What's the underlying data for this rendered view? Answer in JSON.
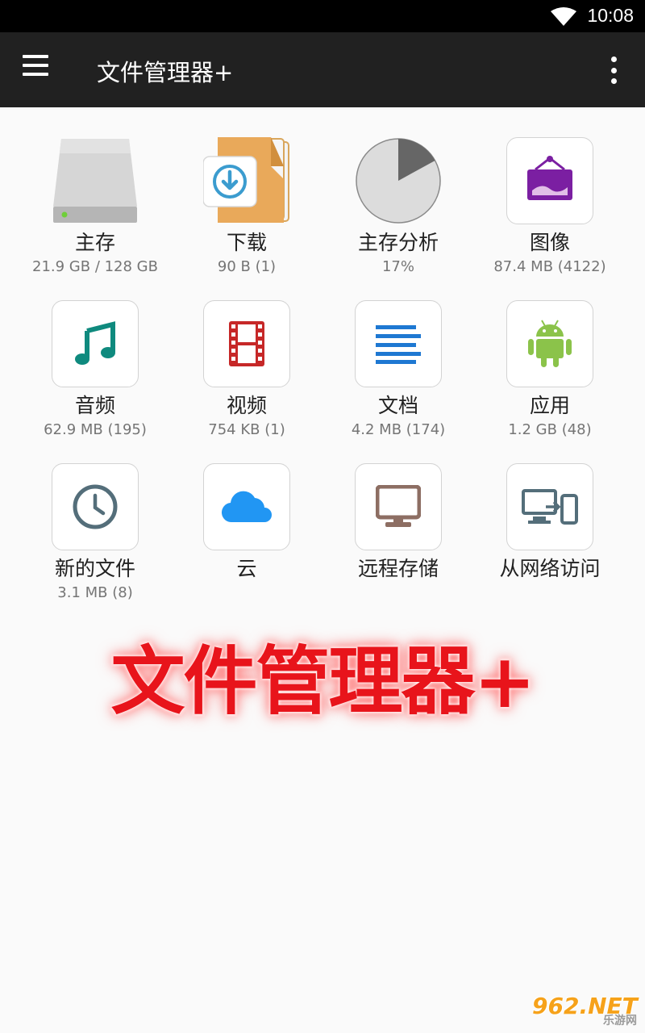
{
  "status_bar": {
    "time": "10:08",
    "wifi_icon": "wifi-icon"
  },
  "toolbar": {
    "title": "文件管理器+",
    "menu_icon": "hamburger-menu-icon",
    "more_icon": "more-vert-icon"
  },
  "items": [
    {
      "label": "主存",
      "sub": "21.9 GB / 128 GB",
      "icon": "hard-drive-icon"
    },
    {
      "label": "下载",
      "sub": "90 B (1)",
      "icon": "download-folder-icon"
    },
    {
      "label": "主存分析",
      "sub": "17%",
      "icon": "storage-pie-icon",
      "used_fraction": 0.17
    },
    {
      "label": "图像",
      "sub": "87.4 MB (4122)",
      "icon": "image-frame-icon"
    },
    {
      "label": "音频",
      "sub": "62.9 MB (195)",
      "icon": "music-note-icon"
    },
    {
      "label": "视频",
      "sub": "754 KB (1)",
      "icon": "film-strip-icon"
    },
    {
      "label": "文档",
      "sub": "4.2 MB (174)",
      "icon": "document-lines-icon"
    },
    {
      "label": "应用",
      "sub": "1.2 GB (48)",
      "icon": "android-icon"
    },
    {
      "label": "新的文件",
      "sub": "3.1 MB (8)",
      "icon": "clock-icon"
    },
    {
      "label": "云",
      "sub": "",
      "icon": "cloud-icon"
    },
    {
      "label": "远程存储",
      "sub": "",
      "icon": "monitor-icon"
    },
    {
      "label": "从网络访问",
      "sub": "",
      "icon": "devices-icon"
    }
  ],
  "promo": {
    "text": "文件管理器+"
  },
  "watermark": {
    "main": "962.NET",
    "sub": "乐游网"
  },
  "colors": {
    "toolbar_bg": "#212121",
    "status_bg": "#000000",
    "promo_red": "#e8141b",
    "audio_teal": "#0f8a7e",
    "video_red": "#c62828",
    "doc_blue": "#1e78d2",
    "android_green": "#8bc34a",
    "image_purple": "#7b1fa2",
    "cloud_blue": "#2196f3",
    "monitor_brown": "#8d6e63",
    "devices_gray": "#546e7a"
  }
}
